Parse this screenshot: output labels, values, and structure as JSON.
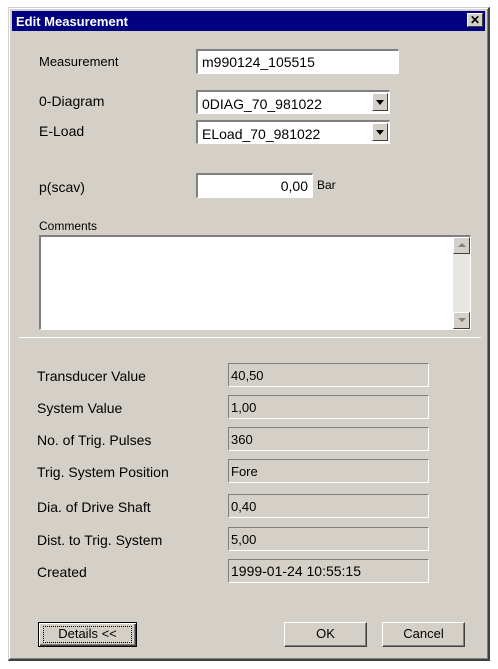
{
  "window": {
    "title": "Edit Measurement",
    "close_glyph": "✕"
  },
  "form": {
    "measurement": {
      "label": "Measurement",
      "value": "m990124_105515"
    },
    "diagram": {
      "label": "0-Diagram",
      "value": "0DIAG_70_981022"
    },
    "eload": {
      "label": "E-Load",
      "value": "ELoad_70_981022"
    },
    "pscav": {
      "label": "p(scav)",
      "value": "0,00",
      "unit": "Bar"
    },
    "comments": {
      "label": "Comments",
      "value": ""
    }
  },
  "details": {
    "transducer_value": {
      "label": "Transducer Value",
      "value": "40,50"
    },
    "system_value": {
      "label": "System Value",
      "value": "1,00"
    },
    "trig_pulses": {
      "label": "No. of Trig. Pulses",
      "value": "360"
    },
    "trig_position": {
      "label": "Trig. System Position",
      "value": "Fore"
    },
    "drive_shaft": {
      "label": "Dia. of Drive Shaft",
      "value": "0,40"
    },
    "dist_trig": {
      "label": "Dist. to Trig. System",
      "value": "5,00"
    },
    "created": {
      "label": "Created",
      "value": "1999-01-24 10:55:15"
    }
  },
  "buttons": {
    "details": "Details <<",
    "ok": "OK",
    "cancel": "Cancel"
  },
  "colors": {
    "titlebar": "#000080",
    "face": "#d4d0c8"
  }
}
